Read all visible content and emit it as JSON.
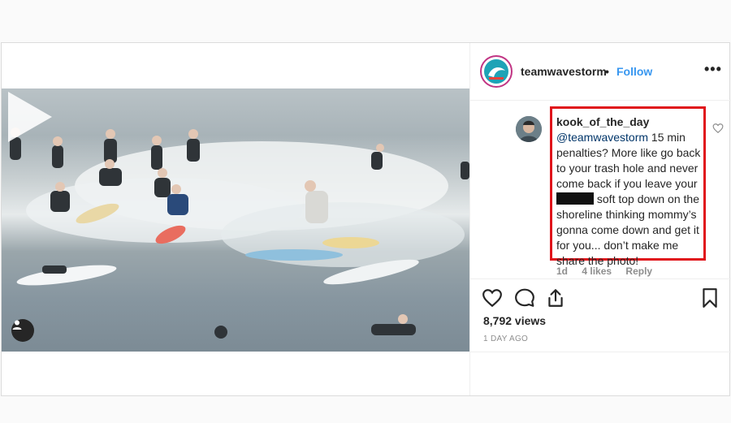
{
  "post": {
    "username": "teamwavestorm",
    "separator": "•",
    "follow_label": "Follow",
    "more_icon": "•••"
  },
  "comment": {
    "username": "kook_of_the_day",
    "mention": "@teamwavestorm",
    "text_1": " 15 min penalties? More like go back to your trash hole and never come back if you leave your ",
    "text_2": " soft top down on the shoreline thinking mommy’s gonna come down and get it for you... don’t make me share the photo!",
    "age": "1d",
    "likes": "4 likes",
    "reply_label": "Reply"
  },
  "stats": {
    "views": "8,792 views",
    "posted": "1 DAY AGO"
  },
  "colors": {
    "link": "#3897f0",
    "highlight_border": "#e0141b",
    "brand_avatar": "#1ea3b6"
  },
  "icons": [
    "play-icon",
    "user-tag-icon",
    "more-icon",
    "heart-icon",
    "comment-icon",
    "share-icon",
    "bookmark-icon"
  ]
}
